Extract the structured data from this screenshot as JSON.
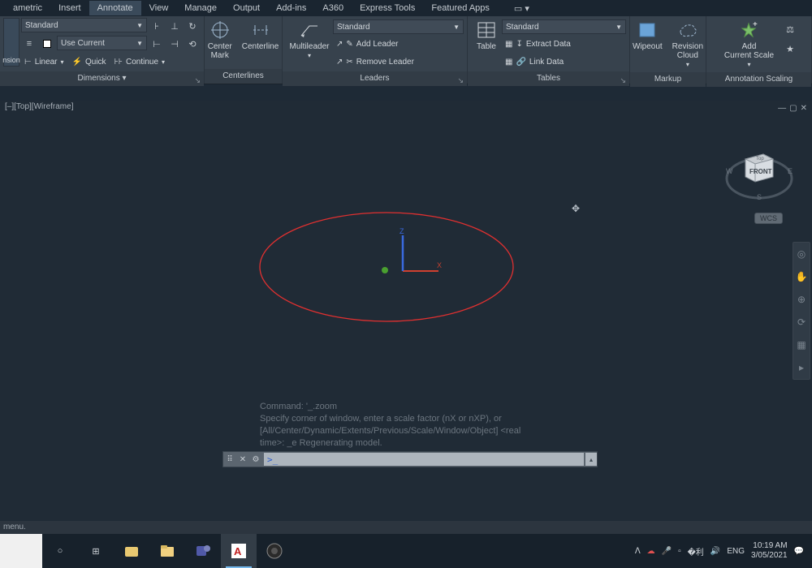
{
  "tabs": {
    "items": [
      "ametric",
      "Insert",
      "Annotate",
      "View",
      "Manage",
      "Output",
      "Add-ins",
      "A360",
      "Express Tools",
      "Featured Apps"
    ],
    "active": 2
  },
  "ribbon": {
    "dimensions": {
      "label": "Dimensions",
      "style_dropdown": "Standard",
      "usecurrent": "Use Current",
      "linear": "Linear",
      "quick": "Quick",
      "continue": "Continue",
      "partial_btn": "nsion"
    },
    "centerlines": {
      "label": "Centerlines",
      "centermark": "Center\nMark",
      "centerline": "Centerline"
    },
    "leaders": {
      "label": "Leaders",
      "style": "Standard",
      "multileader": "Multileader",
      "add": "Add Leader",
      "remove": "Remove Leader"
    },
    "tables": {
      "label": "Tables",
      "style": "Standard",
      "table": "Table",
      "extract": "Extract Data",
      "link": "Link Data"
    },
    "markup": {
      "label": "Markup",
      "wipeout": "Wipeout",
      "revcloud": "Revision\nCloud"
    },
    "scaling": {
      "label": "Annotation Scaling",
      "add": "Add\nCurrent Scale"
    }
  },
  "viewport": {
    "tag": "[–][Top][Wireframe]",
    "cube": {
      "front": "FRONT",
      "top": "Top",
      "w": "W",
      "e": "E",
      "s": "S"
    },
    "wcs": "WCS",
    "axes": {
      "x": "X",
      "z": "Z"
    }
  },
  "command": {
    "hist1": "Command: '_.zoom",
    "hist2": "Specify corner of window, enter a scale factor (nX or nXP), or",
    "hist3": "[All/Center/Dynamic/Extents/Previous/Scale/Window/Object] <real",
    "hist4": "time>: _e Regenerating model.",
    "prompt": ">_"
  },
  "status": {
    "menu": "menu."
  },
  "taskbar": {
    "lang": "ENG",
    "time": "10:19 AM",
    "date": "3/05/2021"
  }
}
